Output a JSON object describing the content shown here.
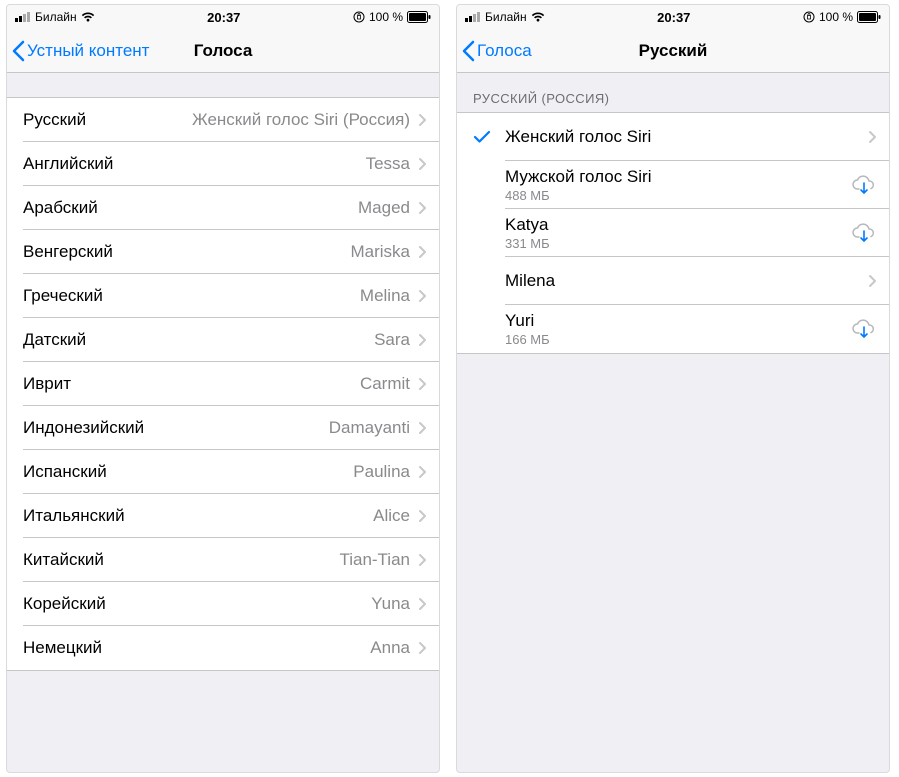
{
  "status": {
    "carrier": "Билайн",
    "time": "20:37",
    "battery": "100 %",
    "charging_icon": "⏾"
  },
  "left": {
    "back_label": "Устный контент",
    "title": "Голоса",
    "languages": [
      {
        "label": "Русский",
        "value": "Женский голос Siri (Россия)"
      },
      {
        "label": "Английский",
        "value": "Tessa"
      },
      {
        "label": "Арабский",
        "value": "Maged"
      },
      {
        "label": "Венгерский",
        "value": "Mariska"
      },
      {
        "label": "Греческий",
        "value": "Melina"
      },
      {
        "label": "Датский",
        "value": "Sara"
      },
      {
        "label": "Иврит",
        "value": "Carmit"
      },
      {
        "label": "Индонезийский",
        "value": "Damayanti"
      },
      {
        "label": "Испанский",
        "value": "Paulina"
      },
      {
        "label": "Итальянский",
        "value": "Alice"
      },
      {
        "label": "Китайский",
        "value": "Tian-Tian"
      },
      {
        "label": "Корейский",
        "value": "Yuna"
      },
      {
        "label": "Немецкий",
        "value": "Anna"
      }
    ]
  },
  "right": {
    "back_label": "Голоса",
    "title": "Русский",
    "section_header": "РУССКИЙ (РОССИЯ)",
    "voices": [
      {
        "name": "Женский голос Siri",
        "size": "",
        "selected": true,
        "action": "disclose"
      },
      {
        "name": "Мужской голос Siri",
        "size": "488 МБ",
        "selected": false,
        "action": "download"
      },
      {
        "name": "Katya",
        "size": "331 МБ",
        "selected": false,
        "action": "download"
      },
      {
        "name": "Milena",
        "size": "",
        "selected": false,
        "action": "disclose"
      },
      {
        "name": "Yuri",
        "size": "166 МБ",
        "selected": false,
        "action": "download"
      }
    ]
  }
}
